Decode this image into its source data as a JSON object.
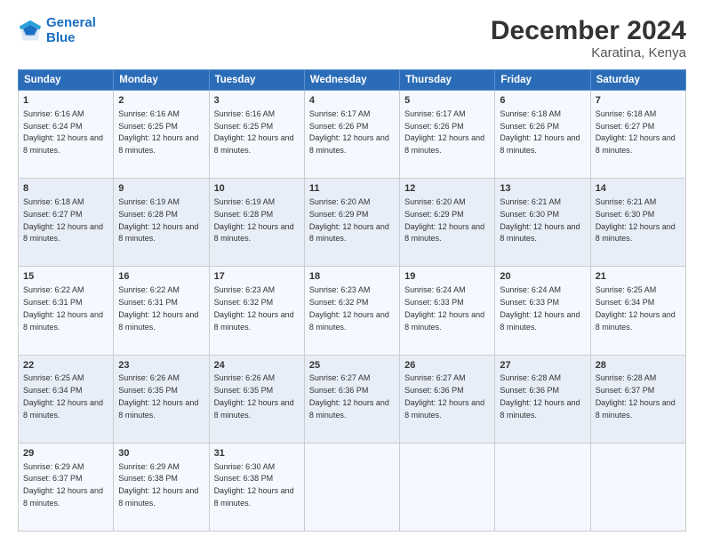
{
  "logo": {
    "line1": "General",
    "line2": "Blue"
  },
  "title": "December 2024",
  "subtitle": "Karatina, Kenya",
  "headers": [
    "Sunday",
    "Monday",
    "Tuesday",
    "Wednesday",
    "Thursday",
    "Friday",
    "Saturday"
  ],
  "weeks": [
    [
      {
        "day": "1",
        "rise": "6:16 AM",
        "set": "6:24 PM",
        "daylight": "12 hours and 8 minutes."
      },
      {
        "day": "2",
        "rise": "6:16 AM",
        "set": "6:25 PM",
        "daylight": "12 hours and 8 minutes."
      },
      {
        "day": "3",
        "rise": "6:16 AM",
        "set": "6:25 PM",
        "daylight": "12 hours and 8 minutes."
      },
      {
        "day": "4",
        "rise": "6:17 AM",
        "set": "6:26 PM",
        "daylight": "12 hours and 8 minutes."
      },
      {
        "day": "5",
        "rise": "6:17 AM",
        "set": "6:26 PM",
        "daylight": "12 hours and 8 minutes."
      },
      {
        "day": "6",
        "rise": "6:18 AM",
        "set": "6:26 PM",
        "daylight": "12 hours and 8 minutes."
      },
      {
        "day": "7",
        "rise": "6:18 AM",
        "set": "6:27 PM",
        "daylight": "12 hours and 8 minutes."
      }
    ],
    [
      {
        "day": "8",
        "rise": "6:18 AM",
        "set": "6:27 PM",
        "daylight": "12 hours and 8 minutes."
      },
      {
        "day": "9",
        "rise": "6:19 AM",
        "set": "6:28 PM",
        "daylight": "12 hours and 8 minutes."
      },
      {
        "day": "10",
        "rise": "6:19 AM",
        "set": "6:28 PM",
        "daylight": "12 hours and 8 minutes."
      },
      {
        "day": "11",
        "rise": "6:20 AM",
        "set": "6:29 PM",
        "daylight": "12 hours and 8 minutes."
      },
      {
        "day": "12",
        "rise": "6:20 AM",
        "set": "6:29 PM",
        "daylight": "12 hours and 8 minutes."
      },
      {
        "day": "13",
        "rise": "6:21 AM",
        "set": "6:30 PM",
        "daylight": "12 hours and 8 minutes."
      },
      {
        "day": "14",
        "rise": "6:21 AM",
        "set": "6:30 PM",
        "daylight": "12 hours and 8 minutes."
      }
    ],
    [
      {
        "day": "15",
        "rise": "6:22 AM",
        "set": "6:31 PM",
        "daylight": "12 hours and 8 minutes."
      },
      {
        "day": "16",
        "rise": "6:22 AM",
        "set": "6:31 PM",
        "daylight": "12 hours and 8 minutes."
      },
      {
        "day": "17",
        "rise": "6:23 AM",
        "set": "6:32 PM",
        "daylight": "12 hours and 8 minutes."
      },
      {
        "day": "18",
        "rise": "6:23 AM",
        "set": "6:32 PM",
        "daylight": "12 hours and 8 minutes."
      },
      {
        "day": "19",
        "rise": "6:24 AM",
        "set": "6:33 PM",
        "daylight": "12 hours and 8 minutes."
      },
      {
        "day": "20",
        "rise": "6:24 AM",
        "set": "6:33 PM",
        "daylight": "12 hours and 8 minutes."
      },
      {
        "day": "21",
        "rise": "6:25 AM",
        "set": "6:34 PM",
        "daylight": "12 hours and 8 minutes."
      }
    ],
    [
      {
        "day": "22",
        "rise": "6:25 AM",
        "set": "6:34 PM",
        "daylight": "12 hours and 8 minutes."
      },
      {
        "day": "23",
        "rise": "6:26 AM",
        "set": "6:35 PM",
        "daylight": "12 hours and 8 minutes."
      },
      {
        "day": "24",
        "rise": "6:26 AM",
        "set": "6:35 PM",
        "daylight": "12 hours and 8 minutes."
      },
      {
        "day": "25",
        "rise": "6:27 AM",
        "set": "6:36 PM",
        "daylight": "12 hours and 8 minutes."
      },
      {
        "day": "26",
        "rise": "6:27 AM",
        "set": "6:36 PM",
        "daylight": "12 hours and 8 minutes."
      },
      {
        "day": "27",
        "rise": "6:28 AM",
        "set": "6:36 PM",
        "daylight": "12 hours and 8 minutes."
      },
      {
        "day": "28",
        "rise": "6:28 AM",
        "set": "6:37 PM",
        "daylight": "12 hours and 8 minutes."
      }
    ],
    [
      {
        "day": "29",
        "rise": "6:29 AM",
        "set": "6:37 PM",
        "daylight": "12 hours and 8 minutes."
      },
      {
        "day": "30",
        "rise": "6:29 AM",
        "set": "6:38 PM",
        "daylight": "12 hours and 8 minutes."
      },
      {
        "day": "31",
        "rise": "6:30 AM",
        "set": "6:38 PM",
        "daylight": "12 hours and 8 minutes."
      },
      {
        "day": "",
        "rise": "",
        "set": "",
        "daylight": ""
      },
      {
        "day": "",
        "rise": "",
        "set": "",
        "daylight": ""
      },
      {
        "day": "",
        "rise": "",
        "set": "",
        "daylight": ""
      },
      {
        "day": "",
        "rise": "",
        "set": "",
        "daylight": ""
      }
    ]
  ]
}
